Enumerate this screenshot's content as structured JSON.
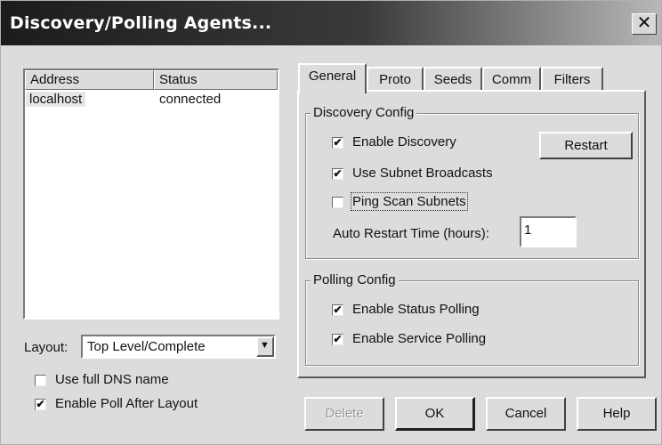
{
  "window": {
    "title": "Discovery/Polling Agents...",
    "close_symbol": "✕"
  },
  "agents": {
    "columns": [
      "Address",
      "Status"
    ],
    "rows": [
      {
        "address": "localhost",
        "status": "connected"
      }
    ]
  },
  "layout": {
    "label": "Layout:",
    "value": "Top Level/Complete",
    "arrow": "▼"
  },
  "options": {
    "use_full_dns": {
      "label": "Use full DNS name",
      "checked": false
    },
    "enable_poll_after_layout": {
      "label": "Enable Poll After Layout",
      "checked": true
    }
  },
  "tabs": [
    "General",
    "Proto",
    "Seeds",
    "Comm",
    "Filters"
  ],
  "discovery_config": {
    "title": "Discovery Config",
    "enable_discovery": {
      "label": "Enable Discovery",
      "checked": true
    },
    "use_subnet_broadcasts": {
      "label": "Use Subnet Broadcasts",
      "checked": true
    },
    "ping_scan_subnets": {
      "label": "Ping Scan Subnets",
      "checked": false
    },
    "restart_label": "Restart",
    "auto_restart_label": "Auto Restart Time (hours):",
    "auto_restart_value": "1"
  },
  "polling_config": {
    "title": "Polling Config",
    "enable_status_polling": {
      "label": "Enable Status Polling",
      "checked": true
    },
    "enable_service_polling": {
      "label": "Enable Service Polling",
      "checked": true
    }
  },
  "buttons": {
    "delete": "Delete",
    "ok": "OK",
    "cancel": "Cancel",
    "help": "Help"
  },
  "check_mark": "✔"
}
